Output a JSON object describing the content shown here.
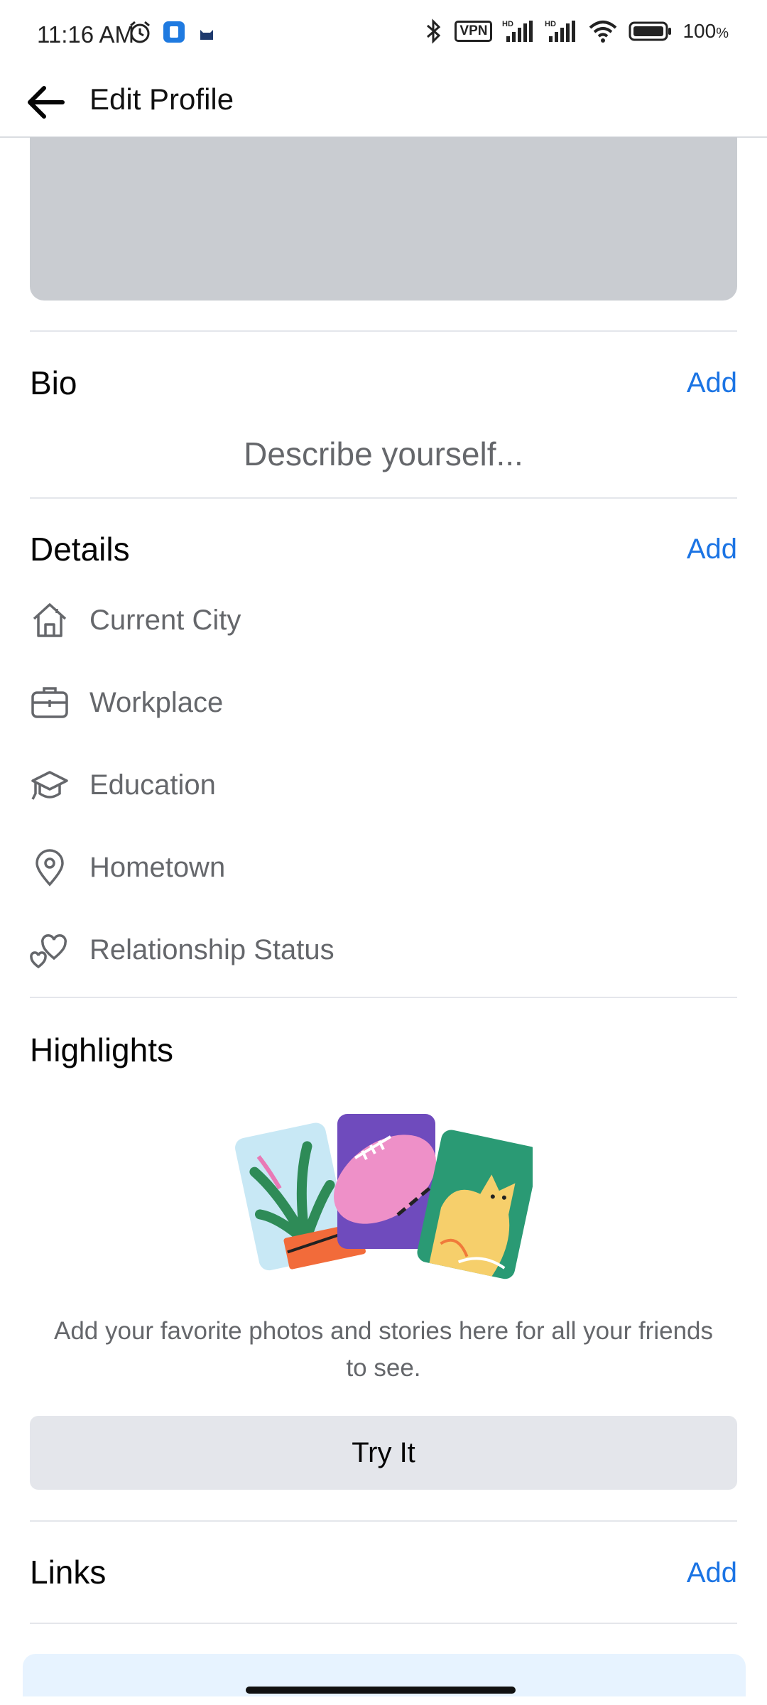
{
  "status_bar": {
    "time": "11:16 AM",
    "vpn_label": "VPN",
    "battery": "100"
  },
  "app_bar": {
    "title": "Edit Profile",
    "back_icon": "arrow-left-icon"
  },
  "bio": {
    "title": "Bio",
    "add_label": "Add",
    "placeholder": "Describe yourself..."
  },
  "details": {
    "title": "Details",
    "add_label": "Add",
    "items": [
      {
        "label": "Current City",
        "icon": "home-icon"
      },
      {
        "label": "Workplace",
        "icon": "briefcase-icon"
      },
      {
        "label": "Education",
        "icon": "graduation-cap-icon"
      },
      {
        "label": "Hometown",
        "icon": "location-pin-icon"
      },
      {
        "label": "Relationship Status",
        "icon": "heart-icon"
      }
    ]
  },
  "highlights": {
    "title": "Highlights",
    "description": "Add your favorite photos and stories here for all your friends to see.",
    "button_label": "Try It"
  },
  "links": {
    "title": "Links",
    "add_label": "Add"
  },
  "colors": {
    "accent": "#1b74e4",
    "cover": "#c9ccd1",
    "secondary_text": "#65676b",
    "button_bg": "#e4e6eb"
  }
}
